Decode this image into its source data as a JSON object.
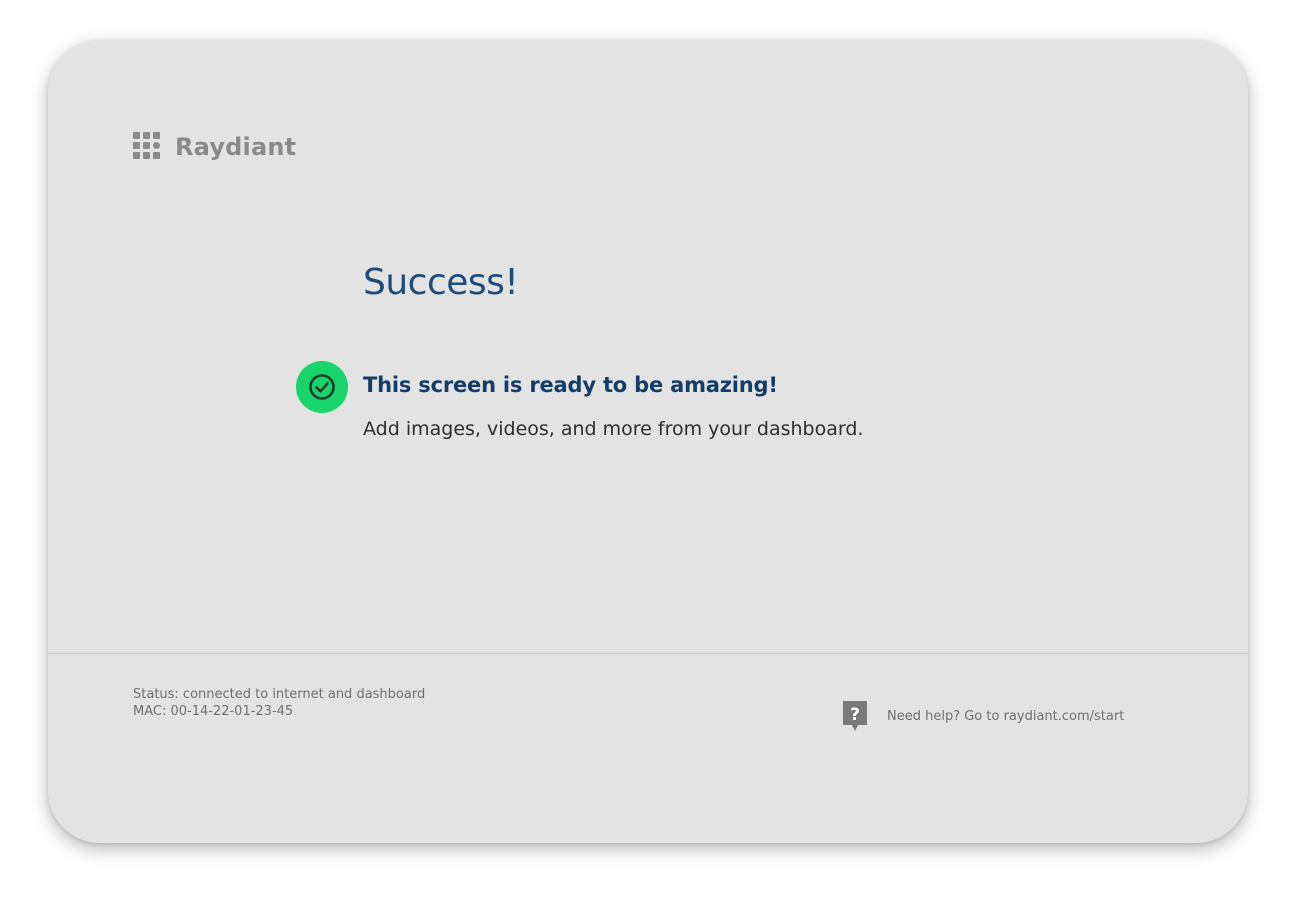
{
  "brand": {
    "name": "Raydiant",
    "logo_icon": "grid-logo-icon",
    "logo_color": "#8a8a8a"
  },
  "main": {
    "title": "Success!",
    "headline": "This screen is ready to be amazing!",
    "subtext": "Add images, videos, and more from your dashboard.",
    "status_icon": "check-circle-icon",
    "status_icon_color": "#19d46a",
    "title_color": "#1e4d7a",
    "headline_color": "#143c68"
  },
  "footer": {
    "status_text": "Status: connected to internet and dashboard",
    "mac_text": "MAC: 00-14-22-01-23-45",
    "help_icon": "question-bubble-icon",
    "help_text": "Need help? Go to raydiant.com/start"
  },
  "colors": {
    "screen_background": "#e3e3e3",
    "muted_text": "#6f6f6f"
  }
}
